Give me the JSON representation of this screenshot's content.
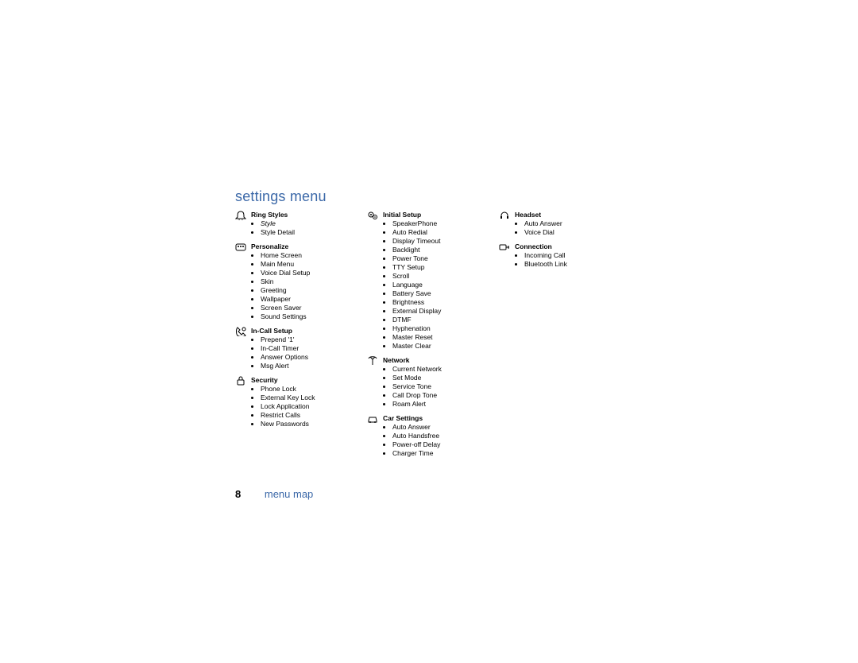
{
  "title": "settings menu",
  "footer": {
    "page": "8",
    "label": "menu map"
  },
  "columns": [
    {
      "sections": [
        {
          "icon": "bell-icon",
          "title": "Ring Styles",
          "items": [
            "Style",
            "Style Detail"
          ],
          "italicFirst": true
        },
        {
          "icon": "palette-icon",
          "title": "Personalize",
          "items": [
            "Home Screen",
            "Main Menu",
            "Voice Dial Setup",
            "Skin",
            "Greeting",
            "Wallpaper",
            "Screen Saver",
            "Sound Settings"
          ]
        },
        {
          "icon": "phone-clock-icon",
          "title": "In-Call Setup",
          "items": [
            "Prepend '1'",
            "In-Call Timer",
            "Answer Options",
            "Msg Alert"
          ]
        },
        {
          "icon": "lock-icon",
          "title": "Security",
          "items": [
            "Phone Lock",
            "External Key Lock",
            "Lock Application",
            "Restrict Calls",
            "New Passwords"
          ]
        }
      ]
    },
    {
      "sections": [
        {
          "icon": "gears-icon",
          "title": "Initial Setup",
          "items": [
            "SpeakerPhone",
            "Auto Redial",
            "Display Timeout",
            "Backlight",
            "Power Tone",
            "TTY Setup",
            "Scroll",
            "Language",
            "Battery Save",
            "Brightness",
            "External Display",
            "DTMF",
            "Hyphenation",
            "Master Reset",
            "Master Clear"
          ]
        },
        {
          "icon": "antenna-icon",
          "title": "Network",
          "items": [
            "Current Network",
            "Set Mode",
            "Service Tone",
            "Call Drop Tone",
            "Roam Alert"
          ]
        },
        {
          "icon": "car-icon",
          "title": "Car Settings",
          "items": [
            "Auto Answer",
            "Auto Handsfree",
            "Power-off Delay",
            "Charger Time"
          ]
        }
      ]
    },
    {
      "sections": [
        {
          "icon": "headset-icon",
          "title": "Headset",
          "items": [
            "Auto Answer",
            "Voice Dial"
          ]
        },
        {
          "icon": "connection-icon",
          "title": "Connection",
          "items": [
            "Incoming Call",
            "Bluetooth Link"
          ]
        }
      ]
    }
  ]
}
